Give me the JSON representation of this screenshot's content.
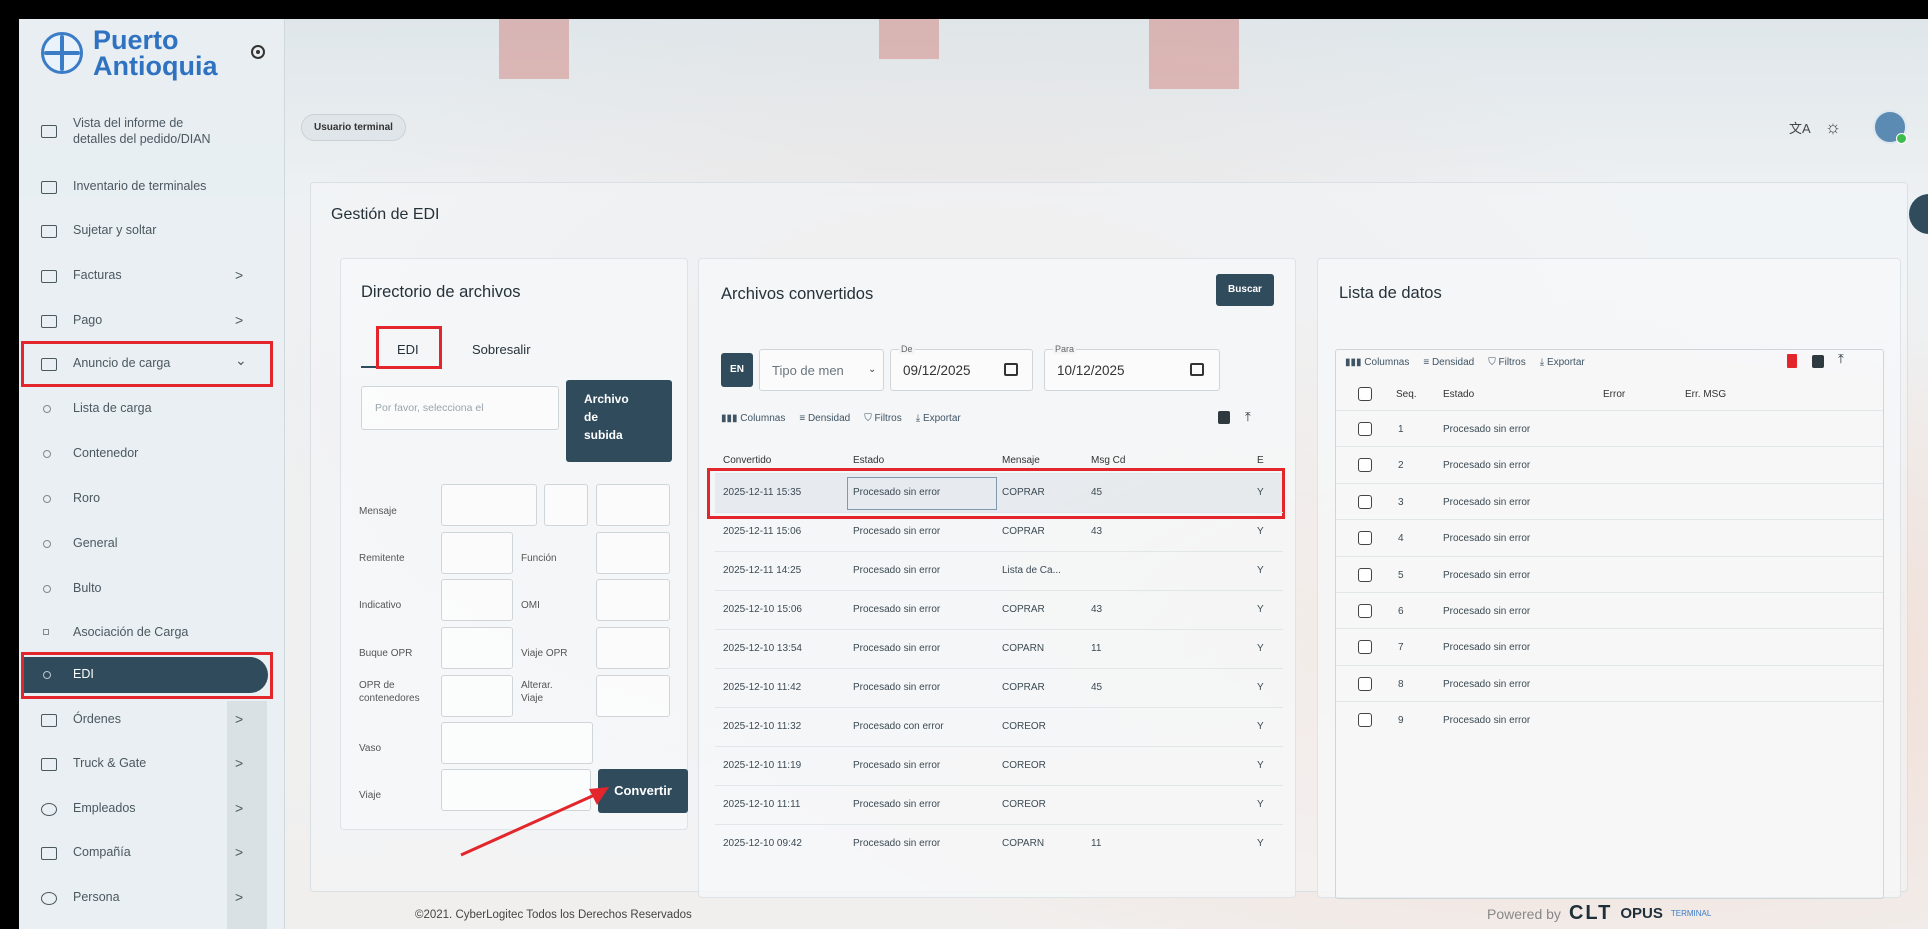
{
  "app": {
    "logo_line1": "Puerto",
    "logo_line2": "Antioquia"
  },
  "sidebar": {
    "items": [
      {
        "label": "Vista del informe de detalles del pedido/DIAN",
        "line1": "Vista del informe de",
        "line2": "detalles del pedido/DIAN"
      },
      {
        "label": "Inventario de terminales"
      },
      {
        "label": "Sujetar y soltar"
      },
      {
        "label": "Facturas",
        "chevron": ">"
      },
      {
        "label": "Pago",
        "chevron": ">"
      },
      {
        "label": "Anuncio de carga",
        "chevron": "⌄"
      },
      {
        "label": "Lista de carga"
      },
      {
        "label": "Contenedor"
      },
      {
        "label": "Roro"
      },
      {
        "label": "General"
      },
      {
        "label": "Bulto"
      },
      {
        "label": "Asociación de Carga"
      },
      {
        "label": "EDI"
      },
      {
        "label": "Órdenes",
        "chevron": ">"
      },
      {
        "label": "Truck & Gate",
        "chevron": ">"
      },
      {
        "label": "Empleados",
        "chevron": ">"
      },
      {
        "label": "Compañía",
        "chevron": ">"
      },
      {
        "label": "Persona",
        "chevron": ">"
      }
    ]
  },
  "header": {
    "role_chip": "Usuario terminal",
    "translate_icon": "文A",
    "theme_icon": "☼"
  },
  "page": {
    "title": "Gestión de EDI"
  },
  "file_directory": {
    "title": "Directorio de archivos",
    "tabs": [
      "EDI",
      "Sobresalir"
    ],
    "file_placeholder": "Por favor, selecciona el",
    "upload_line1": "Archivo",
    "upload_line2": "de",
    "upload_line3": "subida",
    "labels": {
      "mensaje": "Mensaje",
      "remitente": "Remitente",
      "funcion": "Función",
      "indicativo": "Indicativo",
      "omi": "OMI",
      "buque_opr": "Buque OPR",
      "viaje_opr": "Viaje OPR",
      "opr_line1": "OPR de",
      "opr_line2": "contenedores",
      "alterar_line1": "Alterar.",
      "alterar_line2": "Viaje",
      "vaso": "Vaso",
      "viaje": "Viaje"
    },
    "convert_button": "Convertir"
  },
  "converted_files": {
    "title": "Archivos convertidos",
    "search_button": "Buscar",
    "lang_button": "EN",
    "type_placeholder": "Tipo de men",
    "from_label": "De",
    "from_date": "09/12/2025",
    "to_label": "Para",
    "to_date": "10/12/2025",
    "toolbar": [
      "Columnas",
      "Densidad",
      "Filtros",
      "Exportar"
    ],
    "columns": [
      "Convertido",
      "Estado",
      "Mensaje",
      "Msg Cd",
      "E"
    ],
    "rows": [
      [
        "2025-12-11 15:35",
        "Procesado sin error",
        "COPRAR",
        "45",
        "Y"
      ],
      [
        "2025-12-11 15:06",
        "Procesado sin error",
        "COPRAR",
        "43",
        "Y"
      ],
      [
        "2025-12-11 14:25",
        "Procesado sin error",
        "Lista de Ca...",
        "",
        "Y"
      ],
      [
        "2025-12-10 15:06",
        "Procesado sin error",
        "COPRAR",
        "43",
        "Y"
      ],
      [
        "2025-12-10 13:54",
        "Procesado sin error",
        "COPARN",
        "11",
        "Y"
      ],
      [
        "2025-12-10 11:42",
        "Procesado sin error",
        "COPRAR",
        "45",
        "Y"
      ],
      [
        "2025-12-10 11:32",
        "Procesado con error",
        "COREOR",
        "",
        "Y"
      ],
      [
        "2025-12-10 11:19",
        "Procesado sin error",
        "COREOR",
        "",
        "Y"
      ],
      [
        "2025-12-10 11:11",
        "Procesado sin error",
        "COREOR",
        "",
        "Y"
      ],
      [
        "2025-12-10 09:42",
        "Procesado sin error",
        "COPARN",
        "11",
        "Y"
      ]
    ]
  },
  "data_list": {
    "title": "Lista de datos",
    "toolbar": [
      "Columnas",
      "Densidad",
      "Filtros",
      "Exportar"
    ],
    "columns": [
      "Seq.",
      "Estado",
      "Error",
      "Err. MSG"
    ],
    "rows": [
      [
        "1",
        "Procesado sin error"
      ],
      [
        "2",
        "Procesado sin error"
      ],
      [
        "3",
        "Procesado sin error"
      ],
      [
        "4",
        "Procesado sin error"
      ],
      [
        "5",
        "Procesado sin error"
      ],
      [
        "6",
        "Procesado sin error"
      ],
      [
        "7",
        "Procesado sin error"
      ],
      [
        "8",
        "Procesado sin error"
      ],
      [
        "9",
        "Procesado sin error"
      ]
    ]
  },
  "footer": {
    "copyright": "©2021. CyberLogitec Todos los Derechos Reservados",
    "powered_by": "Powered by",
    "brand1": "CLT",
    "brand2": "OPUS",
    "brand3": "TERMINAL"
  },
  "colors": {
    "highlight_red": "#e2262b",
    "dark_button": "#2f4b5c",
    "logo_blue": "#2f72c2"
  }
}
